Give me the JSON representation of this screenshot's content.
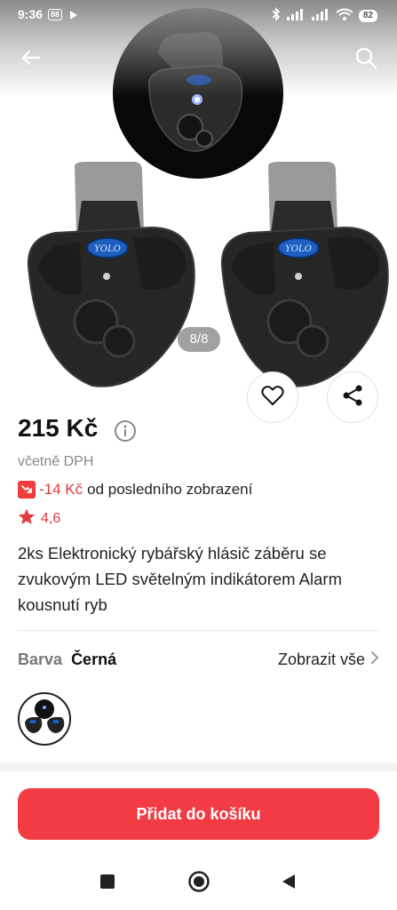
{
  "status_bar": {
    "time": "9:36",
    "badge": "88",
    "battery": "82"
  },
  "gallery": {
    "counter": "8/8",
    "brand_text": "YOLO"
  },
  "product": {
    "price": "215 Kč",
    "vat_note": "včetně DPH",
    "price_drop_value": "-14 Kč",
    "price_drop_text": "od posledního zobrazení",
    "rating": "4,6",
    "title": "2ks Elektronický rybářský hlásič záběru se zvukovým LED světelným indikátorem Alarm kousnutí ryb"
  },
  "variant": {
    "label": "Barva",
    "value": "Černá",
    "show_all": "Zobrazit vše"
  },
  "cart": {
    "add_label": "Přidat do košíku"
  },
  "colors": {
    "accent": "#f33b44",
    "price_drop": "#e23b3b"
  },
  "icons": [
    "back-arrow-icon",
    "search-icon",
    "heart-icon",
    "share-icon",
    "info-icon",
    "price-drop-icon",
    "star-icon",
    "chevron-right-icon"
  ]
}
